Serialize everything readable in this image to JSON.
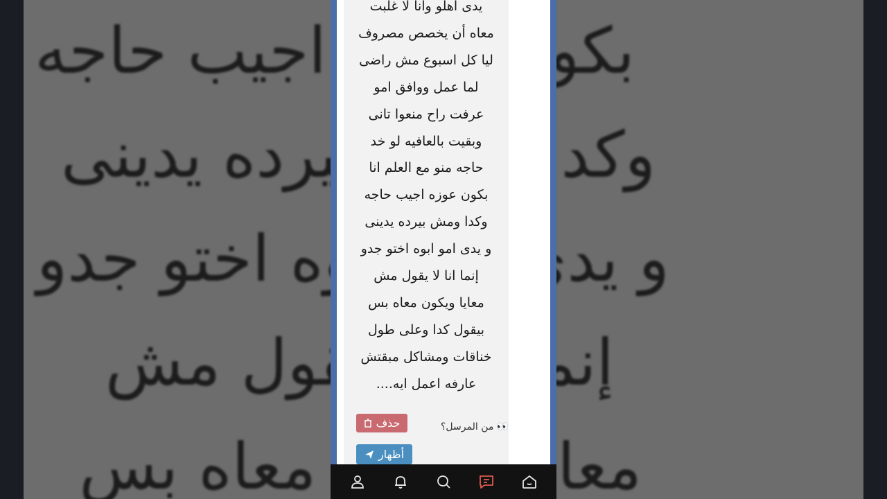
{
  "background": {
    "lines": [
      "بكون عوزه اجيب حاجه",
      "وكدا ومش بيرده يدينى",
      "و يدى امو ابوه اختو جدو",
      "إنما انا لا يقول مش",
      "معايا ويكون معاه بس"
    ]
  },
  "message": {
    "lines": [
      "يدى اهلو وانا لا غلبت",
      "معاه أن يخصص مصروف",
      "ليا كل اسبوع مش راضى",
      "لما عمل ووافق امو",
      "عرفت راح منعوا تانى",
      "وبقيت بالعافيه لو خد",
      "حاجه منو مع العلم انا",
      "بكون عوزه اجيب حاجه",
      "وكدا ومش بيرده يدينى",
      "و يدى امو ابوه اختو جدو",
      "إنما انا لا يقول مش",
      "معايا ويكون معاه بس",
      "بيقول كدا وعلى طول",
      "خناقات ومشاكل مبقتش",
      "عارفه اعمل ايه...."
    ]
  },
  "actions": {
    "sender_label": "👀 من المرسل؟",
    "delete_label": "حذف",
    "show_label": "أظهار"
  },
  "nav": {
    "items": [
      "profile-icon",
      "notifications-icon",
      "search-icon",
      "messages-icon",
      "home-icon"
    ]
  },
  "colors": {
    "phone_border": "#4a6eaa",
    "delete_button": "#c86a70",
    "show_button": "#4a8fbf",
    "messages_active": "#e05a4f"
  }
}
